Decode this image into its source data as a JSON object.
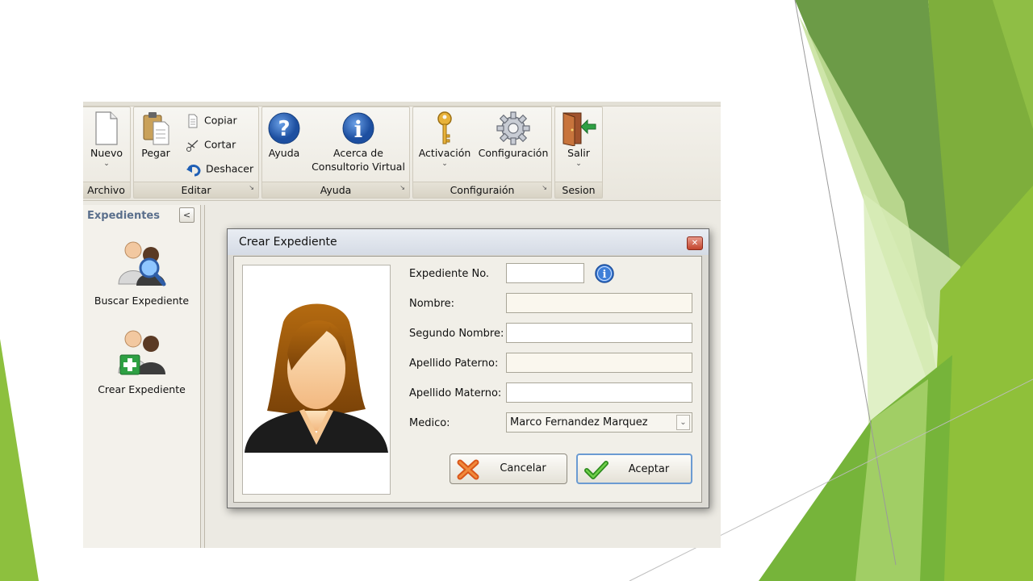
{
  "ribbon": {
    "groups": [
      {
        "label": "Archivo"
      },
      {
        "label": "Editar"
      },
      {
        "label": "Ayuda"
      },
      {
        "label": "Configuraión"
      },
      {
        "label": "Sesion"
      }
    ],
    "buttons": {
      "nuevo": "Nuevo",
      "pegar": "Pegar",
      "copiar": "Copiar",
      "cortar": "Cortar",
      "deshacer": "Deshacer",
      "ayuda": "Ayuda",
      "acerca_line1": "Acerca de",
      "acerca_line2": "Consultorio Virtual",
      "activacion": "Activación",
      "configuracion": "Configuración",
      "salir": "Salir"
    }
  },
  "sidebar": {
    "title": "Expedientes",
    "items": [
      {
        "label": "Buscar Expediente"
      },
      {
        "label": "Crear Expediente"
      }
    ]
  },
  "dialog": {
    "title": "Crear Expediente",
    "fields": [
      {
        "label": "Expediente No.",
        "value": ""
      },
      {
        "label": "Nombre:",
        "value": ""
      },
      {
        "label": "Segundo Nombre:",
        "value": ""
      },
      {
        "label": "Apellido Paterno:",
        "value": ""
      },
      {
        "label": "Apellido Materno:",
        "value": ""
      }
    ],
    "medico": {
      "label": "Medico:",
      "value": "Marco Fernandez Marquez"
    },
    "buttons": {
      "cancel": "Cancelar",
      "accept": "Aceptar"
    }
  },
  "colors": {
    "green_dark": "#5e9a2f",
    "green_mid": "#7fb63a",
    "green_light": "#c8e4a0",
    "accent_blue": "#2f5ea8"
  },
  "icons": {
    "nuevo": "new-document-icon",
    "pegar": "paste-icon",
    "copiar": "copy-icon",
    "cortar": "scissors-icon",
    "deshacer": "undo-icon",
    "ayuda": "help-icon",
    "acerca": "info-icon",
    "activacion": "key-icon",
    "configuracion": "gear-icon",
    "salir": "exit-door-icon"
  }
}
